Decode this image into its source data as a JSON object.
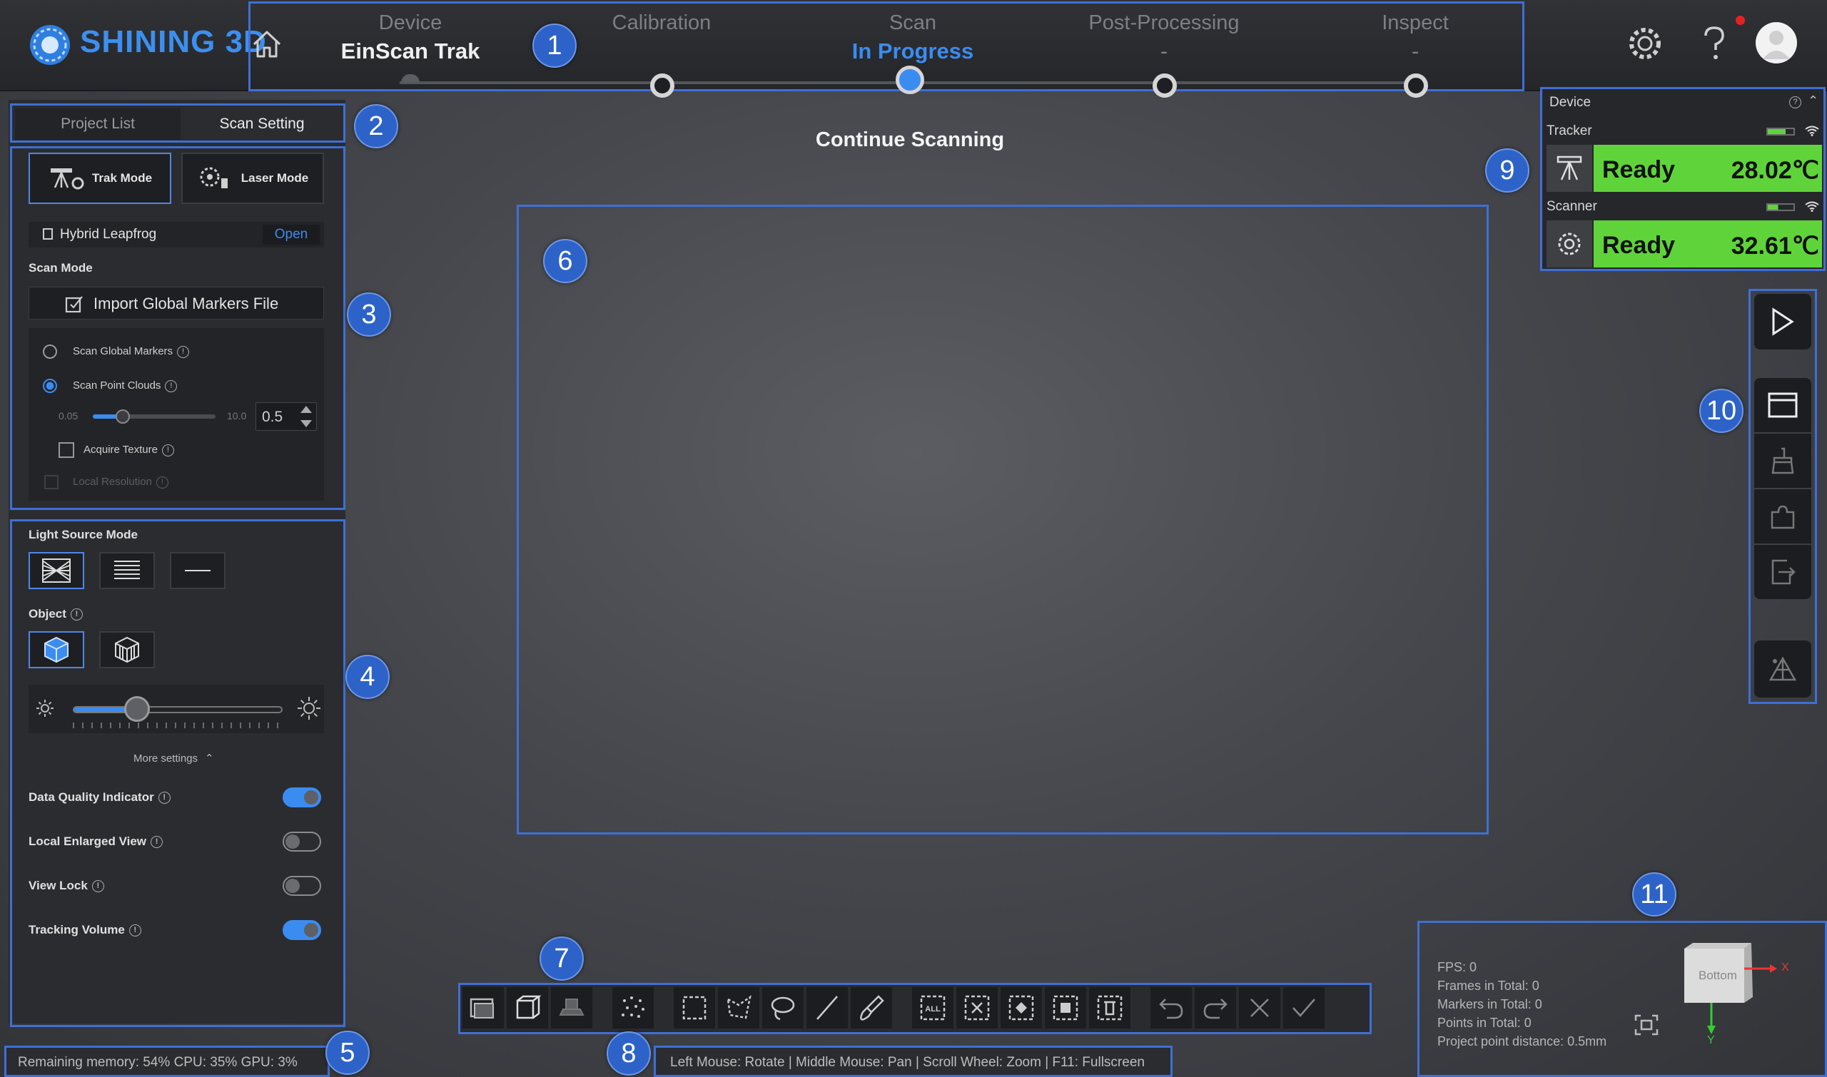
{
  "app": {
    "logo_text": "SHINING 3D"
  },
  "steps": [
    {
      "title": "Device",
      "sub": "EinScan Trak"
    },
    {
      "title": "Calibration",
      "sub": ""
    },
    {
      "title": "Scan",
      "sub": "In Progress"
    },
    {
      "title": "Post-Processing",
      "sub": "-"
    },
    {
      "title": "Inspect",
      "sub": "-"
    }
  ],
  "badges": [
    "1",
    "2",
    "3",
    "4",
    "5",
    "6",
    "7",
    "8",
    "9",
    "10",
    "11"
  ],
  "status_title": "Continue Scanning",
  "left_panel": {
    "tabs": [
      "Project List",
      "Scan Setting"
    ],
    "modes": [
      "Trak Mode",
      "Laser Mode"
    ],
    "hybrid_label": "Hybrid Leapfrog",
    "hybrid_action": "Open",
    "scan_mode_heading": "Scan Mode",
    "import_button": "Import Global Markers File",
    "options": {
      "scan_global_markers": "Scan Global Markers",
      "scan_point_clouds": "Scan Point Clouds",
      "acquire_texture": "Acquire Texture",
      "local_resolution": "Local Resolution"
    },
    "resolution": {
      "min": "0.05",
      "max": "10.0",
      "value": "0.5"
    },
    "light_source_heading": "Light Source Mode",
    "object_heading": "Object",
    "more_settings": "More settings",
    "toggles": [
      {
        "label": "Data Quality Indicator",
        "on": true
      },
      {
        "label": "Local Enlarged View",
        "on": false
      },
      {
        "label": "View Lock",
        "on": false
      },
      {
        "label": "Tracking Volume",
        "on": true
      }
    ]
  },
  "resources": "Remaining memory: 54% CPU: 35% GPU: 3%",
  "hint": "Left Mouse: Rotate | Middle Mouse: Pan | Scroll Wheel: Zoom | F11: Fullscreen",
  "device": {
    "heading": "Device",
    "tracker": {
      "label": "Tracker",
      "status": "Ready",
      "temp": "28.02℃"
    },
    "scanner": {
      "label": "Scanner",
      "status": "Ready",
      "temp": "32.61℃"
    }
  },
  "stats": {
    "fps": "FPS: 0",
    "frames": "Frames in Total: 0",
    "markers": "Markers in Total: 0",
    "points": "Points in Total: 0",
    "distance": "Project point distance: 0.5mm"
  },
  "orientation": {
    "face": "Bottom",
    "x": "X",
    "y": "Y"
  },
  "toolbar_all_label": "ALL",
  "colors": {
    "accent": "#3b8cf0",
    "highlight": "#3f6fd6",
    "ready": "#5fd43a"
  }
}
